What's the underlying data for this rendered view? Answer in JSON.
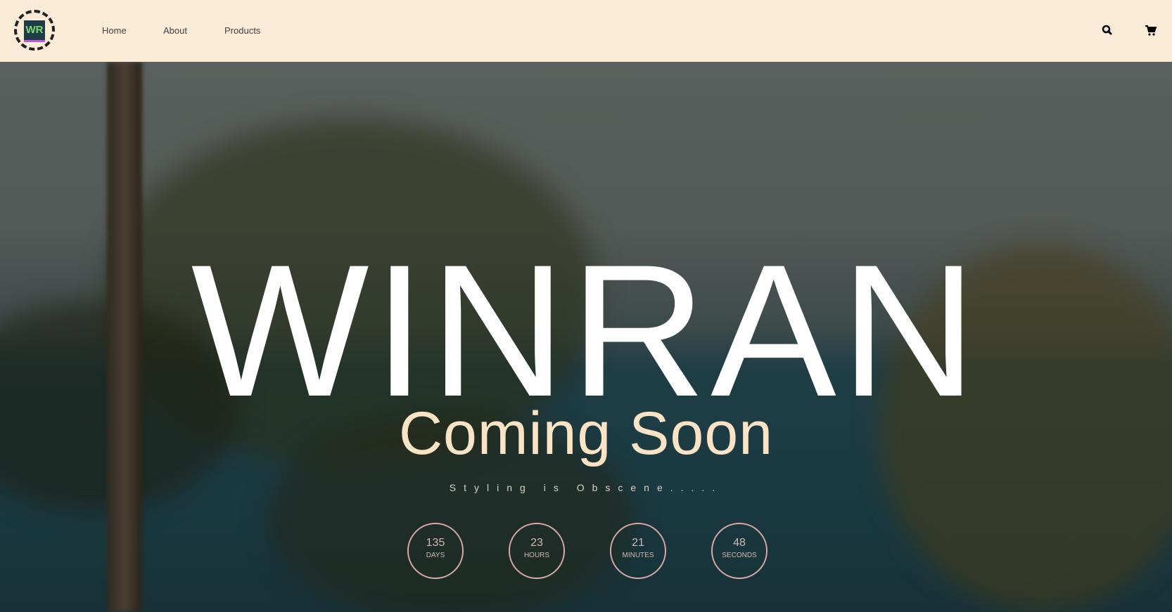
{
  "nav": {
    "logo_text": "WR",
    "links": [
      {
        "label": "Home"
      },
      {
        "label": "About"
      },
      {
        "label": "Products"
      }
    ],
    "icons": [
      "search-icon",
      "cart-icon"
    ]
  },
  "hero": {
    "title": "WINRAN",
    "subtitle": "Coming Soon",
    "tagline": "Styling is Obscene.....",
    "countdown": [
      {
        "value": "135",
        "label": "DAYS"
      },
      {
        "value": "23",
        "label": "HOURS"
      },
      {
        "value": "21",
        "label": "MINUTES"
      },
      {
        "value": "48",
        "label": "SECONDS"
      }
    ]
  },
  "colors": {
    "nav_bg": "#fbebd7",
    "subtitle": "#fbe3c6",
    "circle_border": "#d8a8a6"
  }
}
